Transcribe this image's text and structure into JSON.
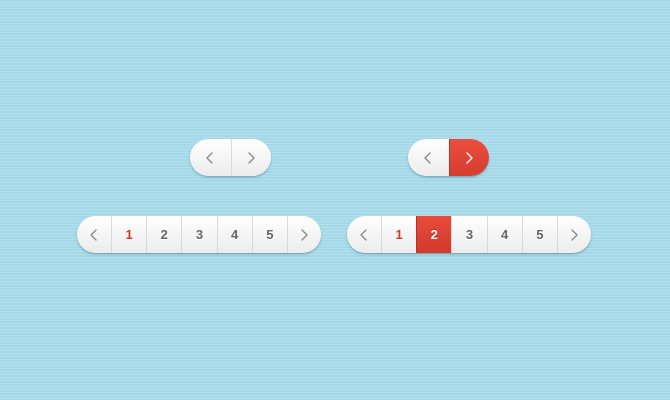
{
  "pager_small_neutral": {
    "prev_icon": "chevron-left-icon",
    "next_icon": "chevron-right-icon"
  },
  "pager_small_active": {
    "prev_icon": "chevron-left-icon",
    "next_icon": "chevron-right-icon",
    "active_segment": "next",
    "accent_color": "#e54a3b"
  },
  "pager_numbered_a": {
    "prev_icon": "chevron-left-icon",
    "next_icon": "chevron-right-icon",
    "pages": [
      "1",
      "2",
      "3",
      "4",
      "5"
    ],
    "current_page": "1",
    "current_style": "red-text",
    "current_text_color": "#d9322a"
  },
  "pager_numbered_b": {
    "prev_icon": "chevron-left-icon",
    "next_icon": "chevron-right-icon",
    "pages": [
      "1",
      "2",
      "3",
      "4",
      "5"
    ],
    "current_page": "2",
    "current_style": "red-fill",
    "accent_color": "#e54a3b"
  }
}
